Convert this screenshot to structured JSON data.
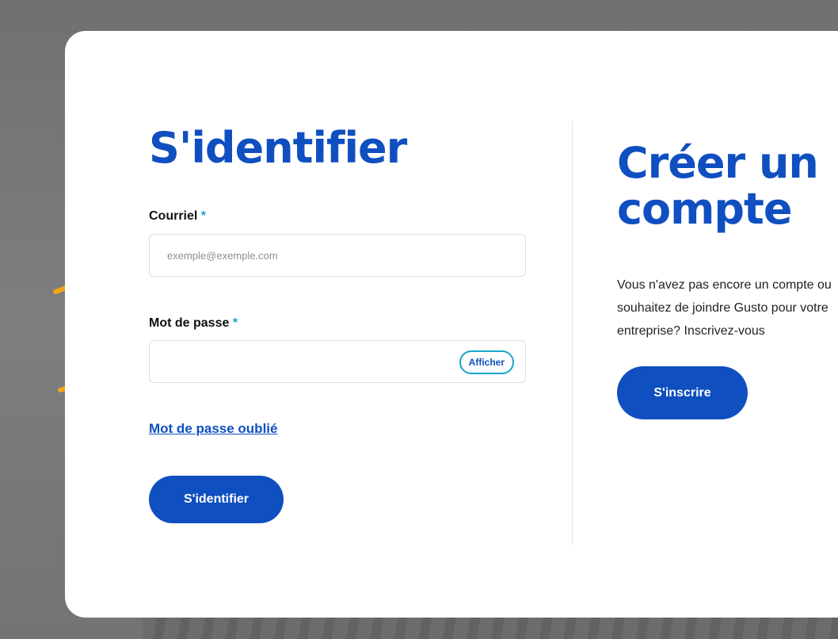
{
  "login": {
    "title": "S'identifier",
    "email_label": "Courriel",
    "email_placeholder": "exemple@exemple.com",
    "email_value": "",
    "password_label": "Mot de passe",
    "password_value": "",
    "required_marker": "*",
    "show_password_label": "Afficher",
    "forgot_password_link": "Mot de passe oublié",
    "submit_label": "S'identifier"
  },
  "signup": {
    "title": "Créer un compte",
    "description": "Vous n'avez pas encore un compte ou souhaitez de joindre Gusto pour votre entreprise? Inscrivez-vous",
    "button_label": "S'inscrire"
  },
  "annotations": {
    "arrow_color": "#f2a516",
    "arrow_icon": "arrow-annotation-icon"
  },
  "colors": {
    "brand_blue": "#0f4fc0",
    "required_cyan": "#17a6c7",
    "overlay_gray": "#7a7b7d"
  }
}
